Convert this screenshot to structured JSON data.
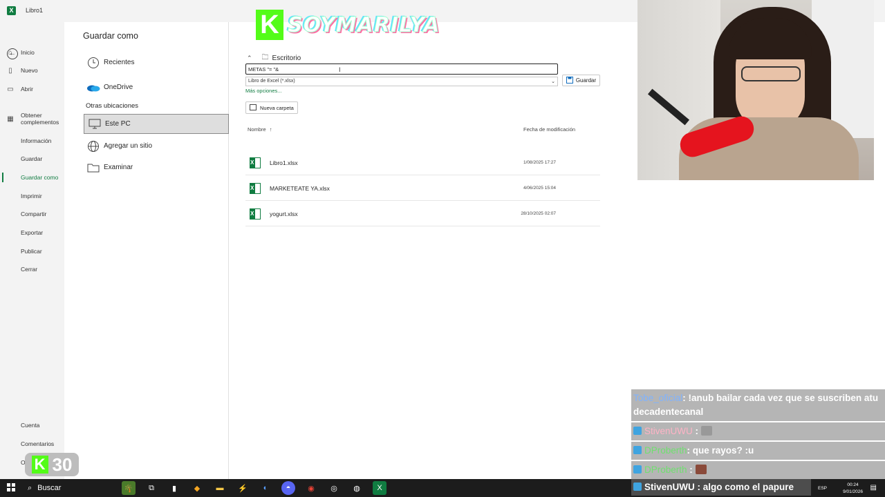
{
  "window": {
    "title": "Libro1",
    "app_icon": "X"
  },
  "nav": {
    "back_icon": "←",
    "items": [
      {
        "label": "Inicio",
        "icon": "⌂"
      },
      {
        "label": "Nuevo",
        "icon": "▯"
      },
      {
        "label": "Abrir",
        "icon": "▭"
      },
      {
        "label": "Obtener\ncomplementos",
        "icon": "▦"
      },
      {
        "label": "Información"
      },
      {
        "label": "Guardar"
      },
      {
        "label": "Guardar como"
      },
      {
        "label": "Imprimir"
      },
      {
        "label": "Compartir"
      },
      {
        "label": "Exportar"
      },
      {
        "label": "Publicar"
      },
      {
        "label": "Cerrar"
      }
    ],
    "bottom_items": [
      {
        "label": "Cuenta"
      },
      {
        "label": "Comentarios"
      },
      {
        "label": "Op"
      }
    ]
  },
  "save_as": {
    "title": "Guardar como",
    "locations": [
      {
        "label": "Recientes",
        "icon": "clock-icon"
      },
      {
        "label": "OneDrive",
        "icon": "onedrive-icon"
      }
    ],
    "other_locations_label": "Otras ubicaciones",
    "other_locations": [
      {
        "label": "Este PC",
        "icon": "pc-icon",
        "selected": true
      },
      {
        "label": "Agregar un sitio",
        "icon": "globe-icon"
      },
      {
        "label": "Examinar",
        "icon": "folder-icon"
      }
    ]
  },
  "main": {
    "breadcrumb": "Escritorio",
    "filename_value": "METAS \"= \"&",
    "filetype_value": "Libro de Excel (*.xlsx)",
    "save_label": "Guardar",
    "more_options": "Más opciones...",
    "new_folder": "Nueva carpeta",
    "col_name": "Nombre",
    "col_date": "Fecha de modificación",
    "files": [
      {
        "name": "Libro1.xlsx",
        "date": "1/08/2025 17:27"
      },
      {
        "name": "MARKETEATE YA.xlsx",
        "date": "4/06/2025 15:04"
      },
      {
        "name": "yogurt.xlsx",
        "date": "28/10/2025 02:07"
      }
    ]
  },
  "overlay": {
    "brand_letter": "K",
    "brand_name": "SOYMARILYA",
    "k30_letter": "K",
    "k30_number": "30",
    "chat": [
      {
        "user": "Tobe_oficial",
        "user_color": "#7fb3ff",
        "text": ": !anub bailar cada vez que se suscriben atu decadentecanal"
      },
      {
        "user": "StivenUWU",
        "user_color": "#ffb3c6",
        "text": " :"
      },
      {
        "user": "DProberth",
        "user_color": "#6fe06f",
        "text": ": que rayos? :u"
      },
      {
        "user": "DProberth",
        "user_color": "#6fe06f",
        "text": " :"
      },
      {
        "user": "StivenUWU",
        "user_color": "#ffffff",
        "text": " : algo como el papure"
      }
    ]
  },
  "taskbar": {
    "search_label": "Buscar",
    "lang": "ESP",
    "time": "00:24",
    "date": "9/01/2026"
  }
}
